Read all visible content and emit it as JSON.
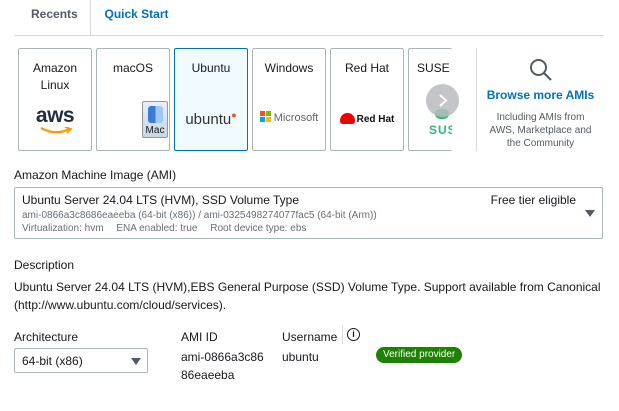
{
  "tabs": {
    "recents": "Recents",
    "quick_start": "Quick Start"
  },
  "os_cards": [
    {
      "name": "Amazon\nLinux",
      "logo_text": "aws"
    },
    {
      "name": "macOS",
      "logo_text": "Mac"
    },
    {
      "name": "Ubuntu",
      "logo_text": "ubuntu",
      "selected": true
    },
    {
      "name": "Windows",
      "logo_text": "Microsoft"
    },
    {
      "name": "Red Hat",
      "logo_text": "Red Hat"
    },
    {
      "name": "SUSE L",
      "logo_text": "SUSE"
    }
  ],
  "browse": {
    "link": "Browse more AMIs",
    "note": "Including AMIs from AWS, Marketplace and the Community"
  },
  "ami": {
    "label": "Amazon Machine Image (AMI)",
    "title": "Ubuntu Server 24.04 LTS (HVM), SSD Volume Type",
    "ids": "ami-0866a3c8686eaeeba (64-bit (x86)) / ami-0325498274077fac5 (64-bit (Arm))",
    "virtualization": "Virtualization: hvm",
    "ena": "ENA enabled: true",
    "root_device": "Root device type: ebs",
    "free_tier": "Free tier eligible"
  },
  "description": {
    "label": "Description",
    "text": "Ubuntu Server 24.04 LTS (HVM),EBS General Purpose (SSD) Volume Type. Support available from Canonical (http://www.ubuntu.com/cloud/services)."
  },
  "architecture": {
    "label": "Architecture",
    "value": "64-bit (x86)"
  },
  "ami_id": {
    "label": "AMI ID",
    "line1": "ami-0866a3c86",
    "line2": "86eaeeba"
  },
  "username": {
    "label": "Username",
    "value": "ubuntu"
  },
  "verified_badge": "Verified provider",
  "colors": {
    "accent": "#0073bb",
    "badge": "#1d8102",
    "selected_bg": "#f1faff"
  },
  "icons": [
    "search-icon",
    "chevron-right-icon",
    "info-icon",
    "caret-down-icon"
  ]
}
